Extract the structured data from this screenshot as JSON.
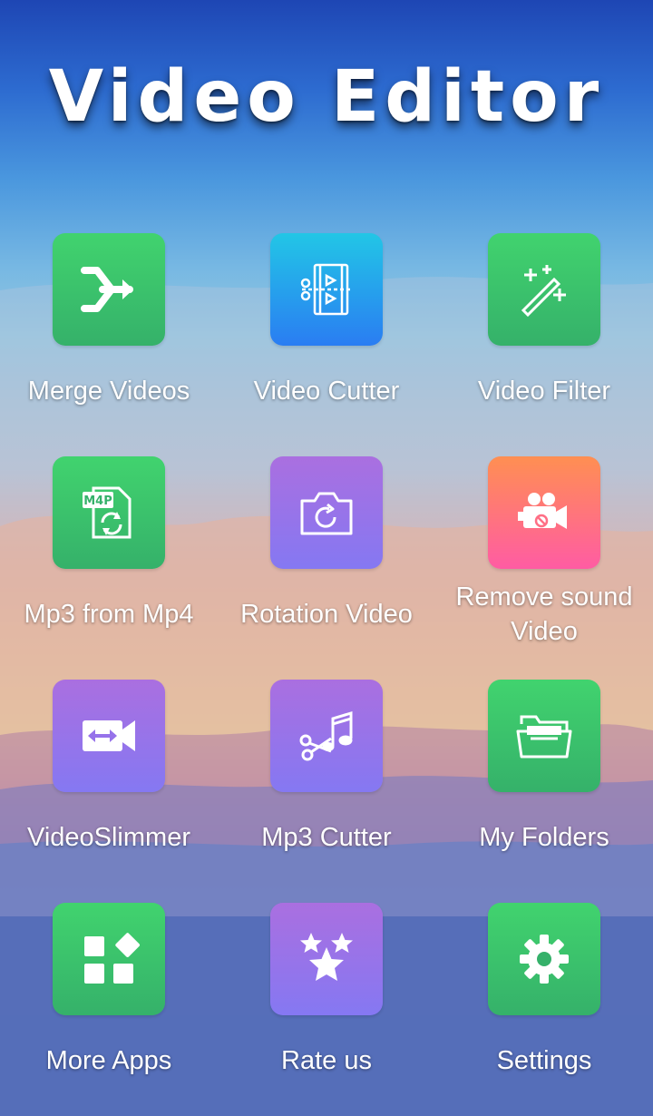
{
  "app": {
    "title": "Video Editor"
  },
  "colors": {
    "green": "#3cc46b",
    "blue": "#2a8ff0",
    "purple": "#9672ea",
    "pink": "#ff6f85"
  },
  "menu": {
    "items": [
      {
        "label": "Merge Videos",
        "icon": "merge-icon"
      },
      {
        "label": "Video Cutter",
        "icon": "video-cut-icon"
      },
      {
        "label": "Video Filter",
        "icon": "magic-wand-icon"
      },
      {
        "label": "Mp3 from Mp4",
        "icon": "m4p-convert-icon",
        "icon_text": "M4P"
      },
      {
        "label": "Rotation Video",
        "icon": "camera-rotate-icon"
      },
      {
        "label": "Remove sound Video",
        "icon": "mute-video-camera-icon"
      },
      {
        "label": "VideoSlimmer",
        "icon": "video-compress-icon"
      },
      {
        "label": "Mp3 Cutter",
        "icon": "music-cut-icon"
      },
      {
        "label": "My Folders",
        "icon": "folder-icon"
      },
      {
        "label": "More Apps",
        "icon": "apps-grid-icon"
      },
      {
        "label": "Rate us",
        "icon": "stars-icon"
      },
      {
        "label": "Settings",
        "icon": "gear-icon"
      }
    ]
  }
}
